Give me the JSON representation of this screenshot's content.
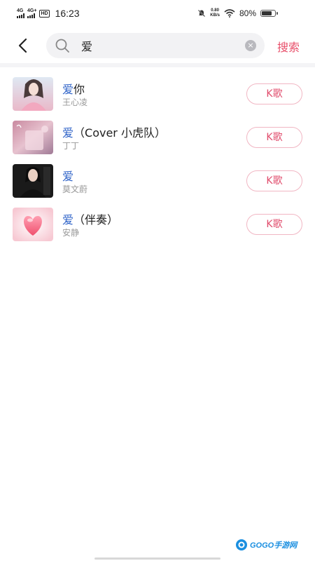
{
  "status_bar": {
    "network1": "4G",
    "network2": "4G+",
    "hd": "HD",
    "time": "16:23",
    "speed_value": "0.80",
    "speed_unit": "KB/s",
    "battery": "80%",
    "battery_level": 0.8
  },
  "search": {
    "query": "爱",
    "clear_icon": "×",
    "search_label": "搜索"
  },
  "results": [
    {
      "title_highlight": "爱",
      "title_rest": "你",
      "artist": "王心凌",
      "action": "K歌",
      "cover": "portrait-pink"
    },
    {
      "title_highlight": "爱",
      "title_rest": "（Cover 小虎队）",
      "artist": "丁丁",
      "action": "K歌",
      "cover": "pink-pastel"
    },
    {
      "title_highlight": "爱",
      "title_rest": "",
      "artist": "莫文蔚",
      "action": "K歌",
      "cover": "dark-portrait"
    },
    {
      "title_highlight": "爱",
      "title_rest": "（伴奏）",
      "artist": "安静",
      "action": "K歌",
      "cover": "heart"
    }
  ],
  "watermark": {
    "text": "GOGO手游网"
  },
  "colors": {
    "accent": "#e14d6d",
    "highlight": "#2f63c8"
  }
}
